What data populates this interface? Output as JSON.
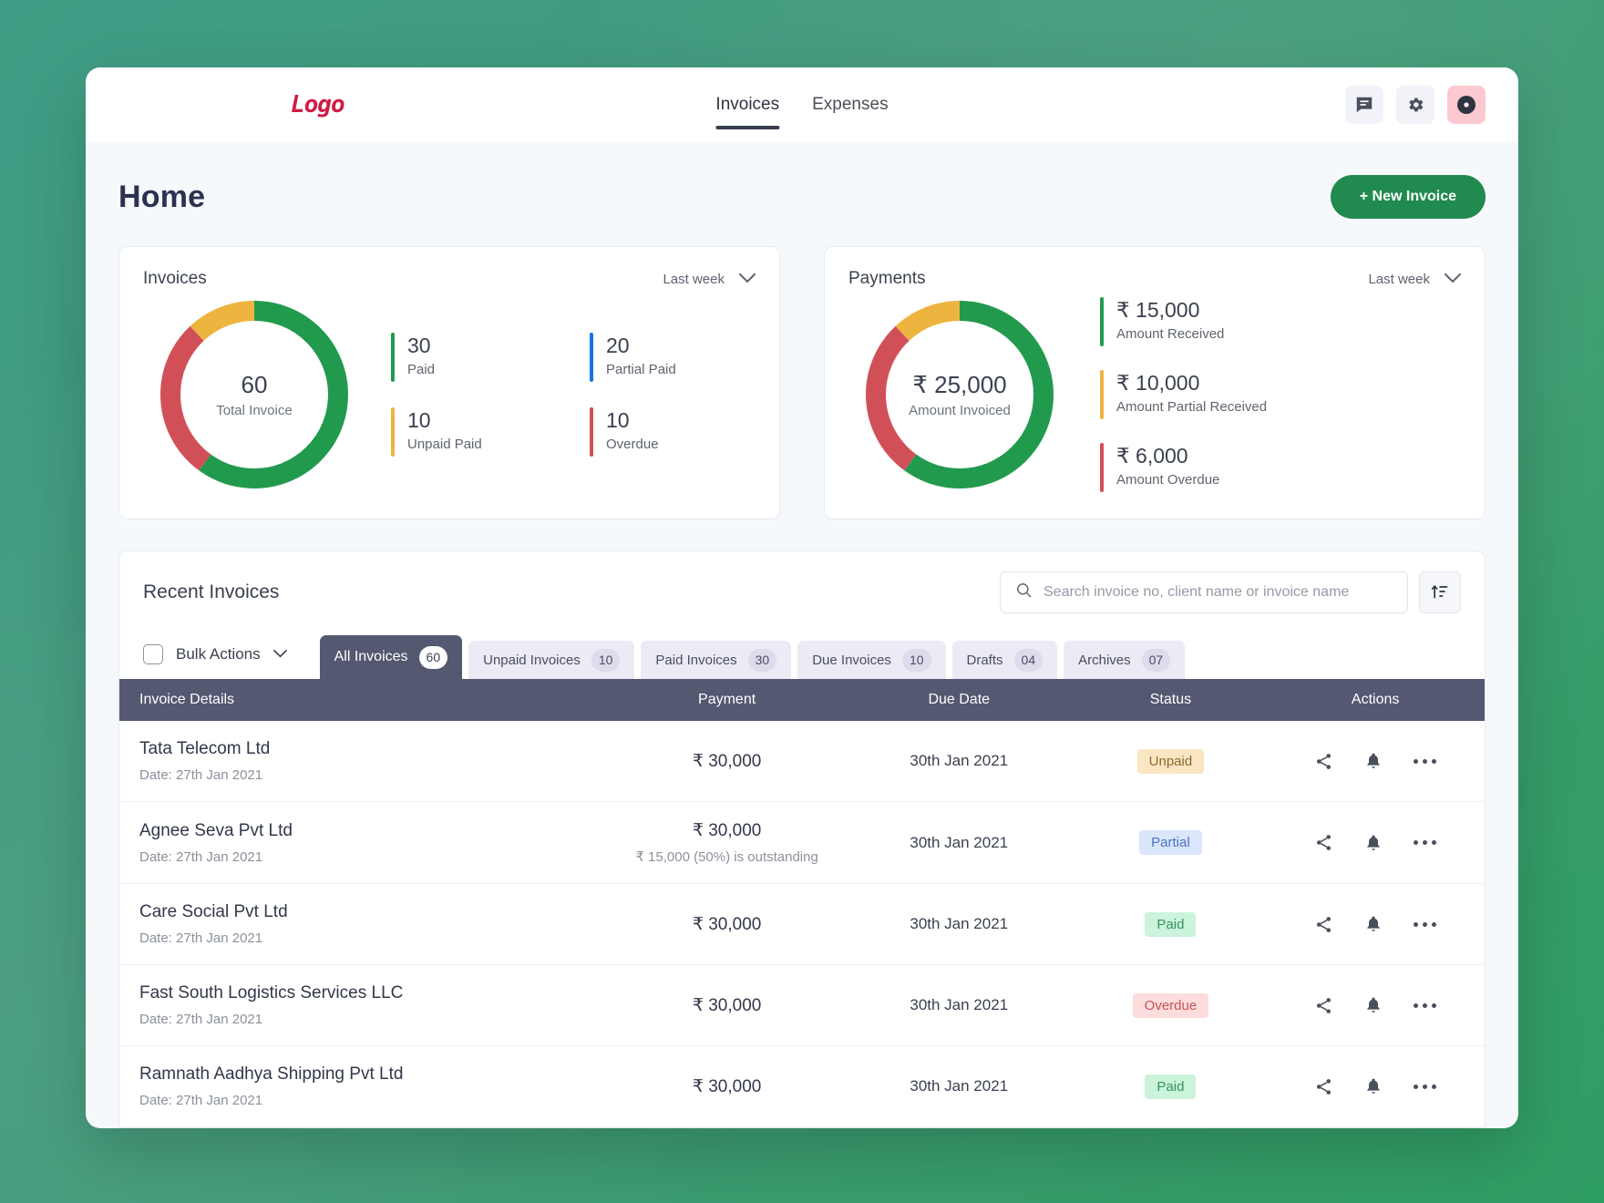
{
  "brand": {
    "logo_text": "Logo",
    "logo_color": "#cf1c45"
  },
  "nav": {
    "items": [
      {
        "label": "Invoices",
        "active": true
      },
      {
        "label": "Expenses",
        "active": false
      }
    ]
  },
  "topbar_actions": [
    {
      "name": "messages-icon",
      "label": "Messages"
    },
    {
      "name": "gear-icon",
      "label": "Settings"
    },
    {
      "name": "avatar",
      "label": "Profile"
    }
  ],
  "page": {
    "title": "Home",
    "new_invoice_label": "+ New Invoice",
    "primary_color": "#218a4e"
  },
  "invoices_card": {
    "title": "Invoices",
    "range": "Last week",
    "center_value": "60",
    "center_label": "Total Invoice",
    "legend": [
      {
        "value": "30",
        "label": "Paid",
        "color": "#229a4e"
      },
      {
        "value": "20",
        "label": "Partial Paid",
        "color": "#1a73e8"
      },
      {
        "value": "10",
        "label": "Unpaid Paid",
        "color": "#edb440"
      },
      {
        "value": "10",
        "label": "Overdue",
        "color": "#d15058"
      }
    ]
  },
  "payments_card": {
    "title": "Payments",
    "range": "Last week",
    "center_value": "₹ 25,000",
    "center_label": "Amount Invoiced",
    "legend": [
      {
        "value": "₹ 15,000",
        "label": "Amount Received",
        "color": "#229a4e"
      },
      {
        "value": "₹ 10,000",
        "label": "Amount Partial Received",
        "color": "#edb440"
      },
      {
        "value": "₹ 6,000",
        "label": "Amount Overdue",
        "color": "#d15058"
      }
    ]
  },
  "recent": {
    "title": "Recent Invoices",
    "search_placeholder": "Search invoice no, client name or invoice name",
    "search_value": "",
    "sort_icon": "sort-icon",
    "bulk_label": "Bulk Actions",
    "tabs": [
      {
        "label": "All Invoices",
        "count": "60",
        "active": true
      },
      {
        "label": "Unpaid Invoices",
        "count": "10",
        "active": false
      },
      {
        "label": "Paid Invoices",
        "count": "30",
        "active": false
      },
      {
        "label": "Due Invoices",
        "count": "10",
        "active": false
      },
      {
        "label": "Drafts",
        "count": "04",
        "active": false
      },
      {
        "label": "Archives",
        "count": "07",
        "active": false
      }
    ],
    "columns": [
      "Invoice Details",
      "Payment",
      "Due Date",
      "Status",
      "Actions"
    ],
    "rows": [
      {
        "name": "Tata Telecom Ltd",
        "date": "Date: 27th Jan 2021",
        "payment": "₹  30,000",
        "payment_sub": "",
        "due": "30th Jan 2021",
        "status": "Unpaid",
        "status_kind": "unpaid"
      },
      {
        "name": "Agnee Seva Pvt Ltd",
        "date": "Date: 27th Jan 2021",
        "payment": "₹  30,000",
        "payment_sub": "₹ 15,000 (50%) is outstanding",
        "due": "30th Jan 2021",
        "status": "Partial",
        "status_kind": "partial"
      },
      {
        "name": "Care Social Pvt Ltd",
        "date": "Date: 27th Jan 2021",
        "payment": "₹  30,000",
        "payment_sub": "",
        "due": "30th Jan 2021",
        "status": "Paid",
        "status_kind": "paid"
      },
      {
        "name": "Fast South Logistics Services LLC",
        "date": "Date: 27th Jan 2021",
        "payment": "₹  30,000",
        "payment_sub": "",
        "due": "30th Jan 2021",
        "status": "Overdue",
        "status_kind": "overdue"
      },
      {
        "name": "Ramnath Aadhya Shipping Pvt Ltd",
        "date": "Date: 27th Jan 2021",
        "payment": "₹  30,000",
        "payment_sub": "",
        "due": "30th Jan 2021",
        "status": "Paid",
        "status_kind": "paid"
      }
    ],
    "row_action_icons": [
      "share-icon",
      "bell-icon",
      "more-options-icon"
    ]
  },
  "chart_data": [
    {
      "type": "pie",
      "title": "Invoices",
      "subtitle": "Last week",
      "center_value": 60,
      "center_label": "Total Invoice",
      "labels": [
        "Paid",
        "Overdue",
        "Unpaid Paid"
      ],
      "values": [
        36,
        17,
        7
      ],
      "colors": [
        "#229a4e",
        "#d15058",
        "#edb440"
      ],
      "legend_position": "right"
    },
    {
      "type": "pie",
      "title": "Payments",
      "subtitle": "Last week",
      "center_value": "₹ 25,000",
      "center_label": "Amount Invoiced",
      "labels": [
        "Amount Received",
        "Amount Overdue",
        "Amount Partial Received"
      ],
      "values": [
        15000,
        6000,
        4000
      ],
      "colors": [
        "#229a4e",
        "#d15058",
        "#edb440"
      ],
      "legend_position": "right"
    }
  ]
}
